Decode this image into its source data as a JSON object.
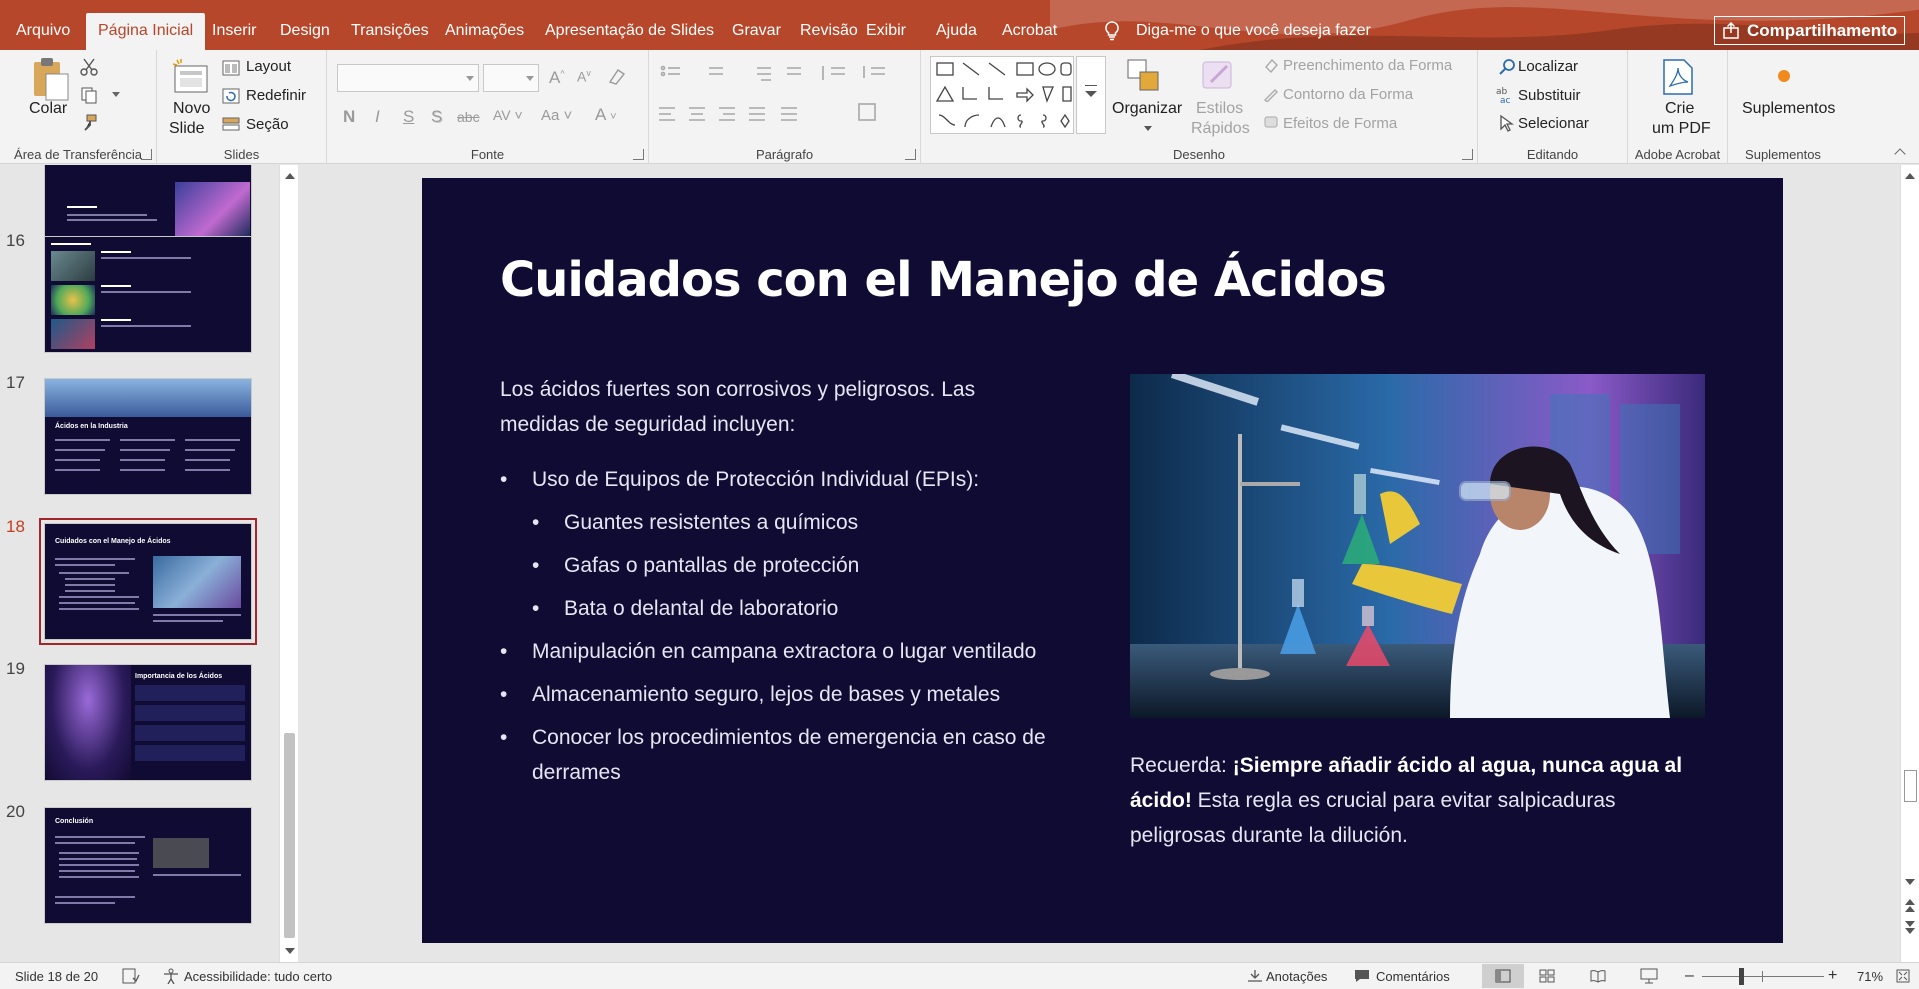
{
  "ribbon_tabs": [
    "Arquivo",
    "Página Inicial",
    "Inserir",
    "Design",
    "Transições",
    "Animações",
    "Apresentação de Slides",
    "Gravar",
    "Revisão",
    "Exibir",
    "Ajuda",
    "Acrobat"
  ],
  "active_tab": "Página Inicial",
  "tell_me": "Diga-me o que você deseja fazer",
  "share_label": "Compartilhamento",
  "groups": {
    "clipboard": {
      "label": "Área de Transferência",
      "paste": "Colar"
    },
    "slides": {
      "label": "Slides",
      "new_slide_1": "Novo",
      "new_slide_2": "Slide",
      "layout": "Layout",
      "reset": "Redefinir",
      "section": "Seção"
    },
    "font": {
      "label": "Fonte"
    },
    "paragraph": {
      "label": "Parágrafo"
    },
    "drawing": {
      "label": "Desenho",
      "arrange": "Organizar",
      "quick_styles_1": "Estilos",
      "quick_styles_2": "Rápidos",
      "fill": "Preenchimento da Forma",
      "outline": "Contorno da Forma",
      "effects": "Efeitos de Forma"
    },
    "editing": {
      "label": "Editando",
      "find": "Localizar",
      "replace": "Substituir",
      "select": "Selecionar"
    },
    "acrobat": {
      "label": "Adobe Acrobat",
      "create_pdf_1": "Crie",
      "create_pdf_2": "um PDF"
    },
    "addins": {
      "label": "Suplementos",
      "addins_btn": "Suplementos"
    }
  },
  "thumbnails": [
    {
      "num": "16"
    },
    {
      "num": "17",
      "title": "Ácidos en la Industria"
    },
    {
      "num": "18",
      "title": "Cuidados con el Manejo de Ácidos"
    },
    {
      "num": "19",
      "title": "Importancia de los Ácidos"
    },
    {
      "num": "20",
      "title": "Conclusión"
    }
  ],
  "selected_slide": "18",
  "slide": {
    "title": "Cuidados con el Manejo de Ácidos",
    "intro": "Los ácidos fuertes son corrosivos y peligrosos. Las medidas de seguridad incluyen:",
    "bullets": [
      {
        "level": 1,
        "text": "Uso de Equipos de Protección Individual (EPIs):"
      },
      {
        "level": 2,
        "text": "Guantes resistentes a químicos"
      },
      {
        "level": 2,
        "text": "Gafas o pantallas de protección"
      },
      {
        "level": 2,
        "text": "Bata o delantal de laboratorio"
      },
      {
        "level": 1,
        "text": "Manipulación en campana extractora o lugar ventilado"
      },
      {
        "level": 1,
        "text": "Almacenamiento seguro, lejos de bases y metales"
      },
      {
        "level": 1,
        "text": "Conocer los procedimientos de emergencia en caso de derrames"
      }
    ],
    "caption_prefix": "Recuerda: ",
    "caption_bold": "¡Siempre añadir ácido al agua, nunca agua al ácido!",
    "caption_rest": " Esta regla es crucial para evitar salpicaduras peligrosas durante la dilución."
  },
  "status": {
    "slide_counter": "Slide 18 de 20",
    "accessibility": "Acessibilidade: tudo certo",
    "notes": "Anotações",
    "comments": "Comentários",
    "zoom": "71%"
  },
  "colors": {
    "accent": "#b7472a",
    "slide_bg": "#0f0b33",
    "selection": "#a4262c"
  }
}
